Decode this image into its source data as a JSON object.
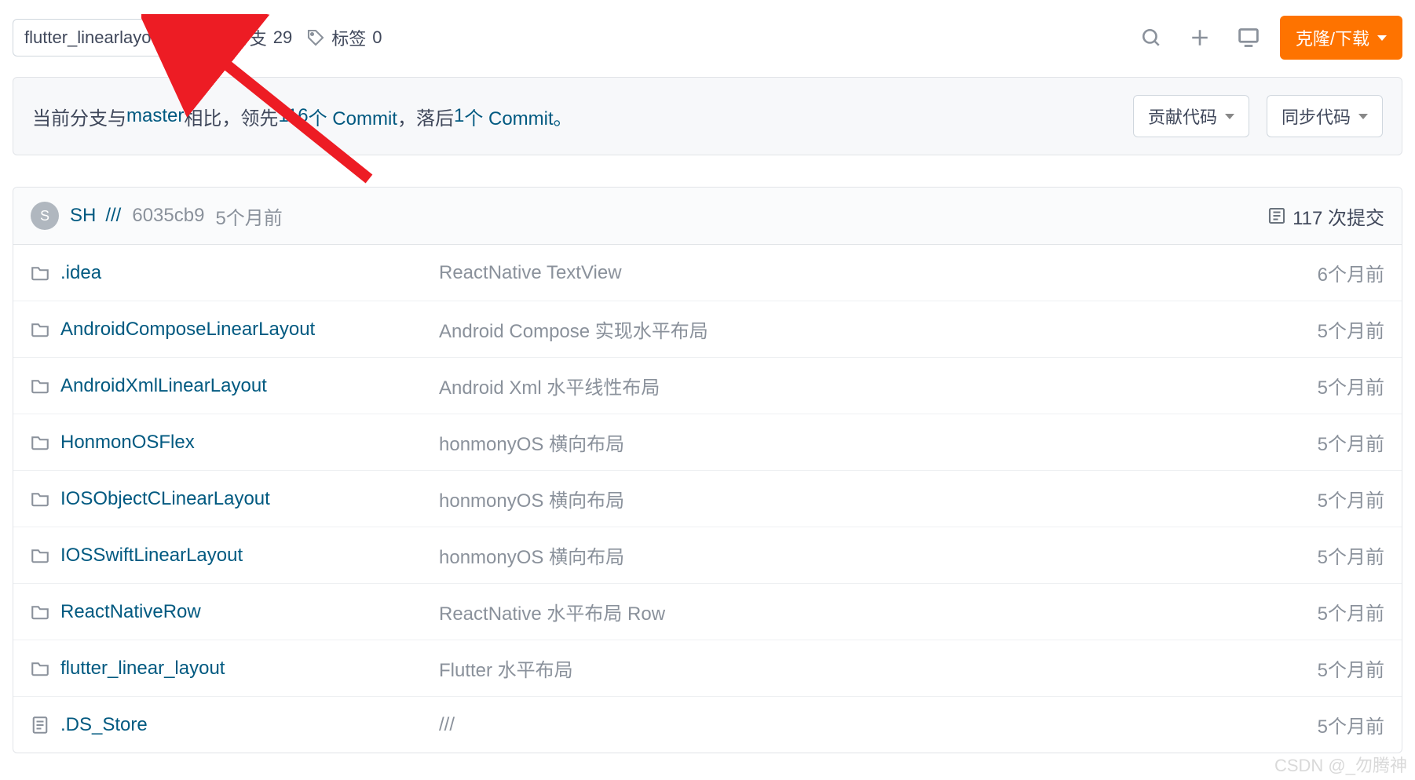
{
  "toolbar": {
    "branch": "flutter_linearlayout",
    "branches_label": "分支",
    "branches_count": "29",
    "tags_label": "标签",
    "tags_count": "0",
    "clone_label": "克隆/下载"
  },
  "compare": {
    "prefix": "当前分支与 ",
    "master": "master",
    "mid1": " 相比，",
    "ahead_pre": "领先 ",
    "ahead_n": "116",
    "ahead_suf": " 个 Commit",
    "behind_sep": "，",
    "behind_pre": "落后 ",
    "behind_n": "1",
    "behind_suf": " 个 Commit。",
    "contribute_btn": "贡献代码",
    "sync_btn": "同步代码"
  },
  "commit": {
    "avatar_initial": "S",
    "author": "SH",
    "message": "///",
    "sha": "6035cb9",
    "time": "5个月前",
    "total_label": "117 次提交"
  },
  "files": [
    {
      "icon": "folder",
      "name": ".idea",
      "msg": "ReactNative TextView",
      "time": "6个月前"
    },
    {
      "icon": "folder",
      "name": "AndroidComposeLinearLayout",
      "msg": "Android Compose 实现水平布局",
      "time": "5个月前"
    },
    {
      "icon": "folder",
      "name": "AndroidXmlLinearLayout",
      "msg": "Android Xml 水平线性布局",
      "time": "5个月前"
    },
    {
      "icon": "folder",
      "name": "HonmonOSFlex",
      "msg": "honmonyOS 横向布局",
      "time": "5个月前"
    },
    {
      "icon": "folder",
      "name": "IOSObjectCLinearLayout",
      "msg": "honmonyOS 横向布局",
      "time": "5个月前"
    },
    {
      "icon": "folder",
      "name": "IOSSwiftLinearLayout",
      "msg": "honmonyOS 横向布局",
      "time": "5个月前"
    },
    {
      "icon": "folder",
      "name": "ReactNativeRow",
      "msg": "ReactNative 水平布局 Row",
      "time": "5个月前"
    },
    {
      "icon": "folder",
      "name": "flutter_linear_layout",
      "msg": "Flutter 水平布局",
      "time": "5个月前"
    },
    {
      "icon": "file",
      "name": ".DS_Store",
      "msg": "///",
      "time": "5个月前"
    }
  ],
  "watermark": "CSDN @_勿腾神"
}
